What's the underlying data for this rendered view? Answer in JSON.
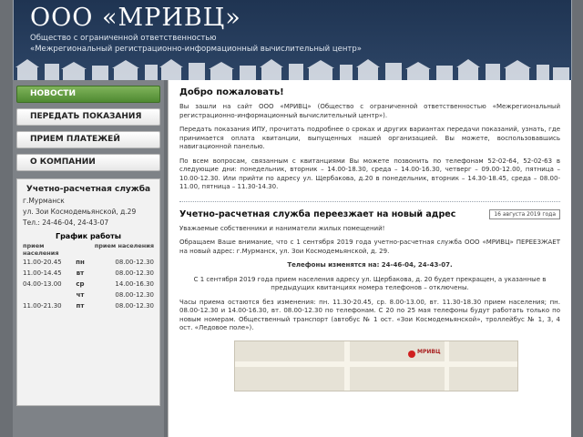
{
  "header": {
    "brand": "ООО «МРИВЦ»",
    "subtitle1": "Общество с ограниченной ответственностью",
    "subtitle2": "«Межрегиональный регистрационно-информационный вычислительный центр»"
  },
  "menu": [
    {
      "label": "НОВОСТИ",
      "active": true
    },
    {
      "label": "ПЕРЕДАТЬ ПОКАЗАНИЯ",
      "active": false
    },
    {
      "label": "ПРИЕМ ПЛАТЕЖЕЙ",
      "active": false
    },
    {
      "label": "О КОМПАНИИ",
      "active": false
    }
  ],
  "info": {
    "title": "Учетно-расчетная служба",
    "city": "г.Мурманск",
    "address": "ул. Зои Космодемьянской, д.29",
    "phones": "Тел.: 24-46-04, 24-43-07",
    "schedule_title": "График работы",
    "schedule_head_left": "прием населения",
    "schedule_head_right": "прием населения",
    "schedule": [
      {
        "left": "11.00-20.45",
        "day": "пн",
        "right": "08.00-12.30"
      },
      {
        "left": "11.00-14.45",
        "day": "вт",
        "right": "08.00-12.30"
      },
      {
        "left": "04.00-13.00",
        "day": "ср",
        "right": "14.00-16.30"
      },
      {
        "left": "",
        "day": "чт",
        "right": "08.00-12.30"
      },
      {
        "left": "11.00-21.30",
        "day": "пт",
        "right": "08.00-12.30"
      }
    ]
  },
  "content": {
    "welcome_title": "Добро пожаловать!",
    "welcome_p1": "Вы зашли на сайт ООО «МРИВЦ» (Общество с ограниченной ответственностью «Межрегиональный регистрационно-информационный вычислительный центр»).",
    "welcome_p2": "Передать показания ИПУ, прочитать подробнее о сроках и других вариантах передачи показаний, узнать, где принимается оплата квитанции, выпущенных нашей организацией. Вы можете, воспользовавшись навигационной панелью.",
    "welcome_p3": "По всем вопросам, связанным с квитанциями Вы можете позвонить по телефонам 52-02-64, 52-02-63 в следующие дни: понедельник, вторник – 14.00-18.30, среда – 14.00-16.30, четверг – 09.00-12.00, пятница – 10.00-12.30. Или прийти по адресу ул. Щербакова, д.20 в понедельник, вторник – 14.30-18.45, среда – 08.00-11.00, пятница – 11.30-14.30.",
    "news_title": "Учетно-расчетная служба переезжает на новый адрес",
    "news_date": "16 августа 2019 года",
    "news_greeting": "Уважаемые собственники и наниматели жилых помещений!",
    "news_p1": "Обращаем Ваше внимание, что с 1 сентября 2019 года учетно-расчетная служба ООО «МРИВЦ» ПЕРЕЕЗЖАЕТ на новый адрес: г.Мурманск, ул. Зои Космодемьянской, д. 29.",
    "news_phones": "Телефоны изменятся на: 24-46-04, 24-43-07.",
    "news_p2": "С 1 сентября 2019 года прием населения адресу ул. Щербакова, д. 20 будет прекращен, а указанные в предыдущих квитанциях номера телефонов – отключены.",
    "news_p3": "Часы приема остаются без изменения: пн. 11.30-20.45, ср. 8.00-13.00, вт. 11.30-18.30 прием населения; пн. 08.00-12.30 и 14.00-16.30, вт. 08.00-12.30 по телефонам. С 20 по 25 мая телефоны будут работать только по новым номерам. Общественный транспорт (автобус № 1 ост. «Зои Космодемьянской», троллейбус № 1, 3, 4 ост. «Ледовое поле»).",
    "map_label": "МРИВЦ"
  }
}
